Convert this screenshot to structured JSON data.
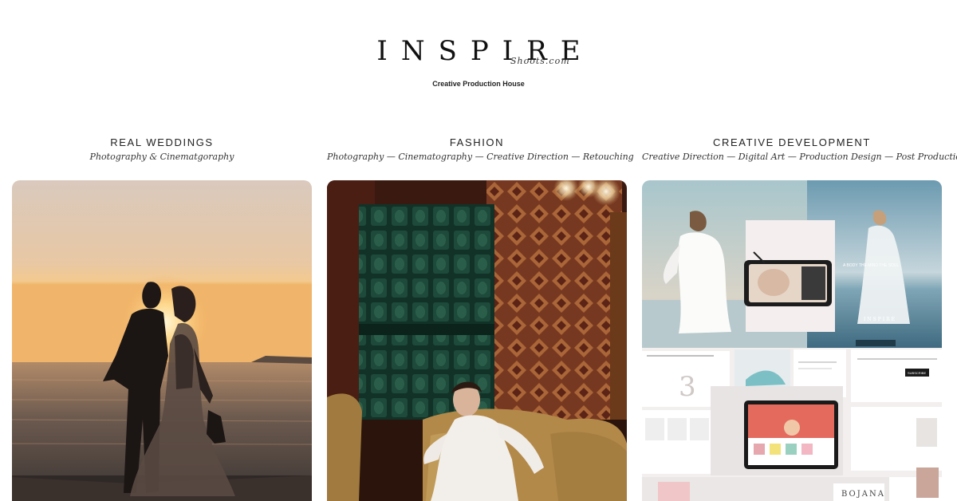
{
  "brand": {
    "logo_word": "INSPIRE",
    "logo_script": "Shoots.com",
    "tagline": "Creative Production House"
  },
  "categories": [
    {
      "title": "REAL WEDDINGS",
      "subtitle": "Photography & Cinematgoraphy"
    },
    {
      "title": "FASHION",
      "subtitle": "Photography — Cinematography — Creative Direction — Retouching"
    },
    {
      "title": "CREATIVE DEVELOPMENT",
      "subtitle": "Creative Direction — Digital Art — Production Design — Post Production"
    }
  ],
  "collage_text": {
    "page_number": "3",
    "button_label": "SUBSCRIBE",
    "mini_logo": "INSPIRE",
    "brand_card": "BOJANA"
  }
}
